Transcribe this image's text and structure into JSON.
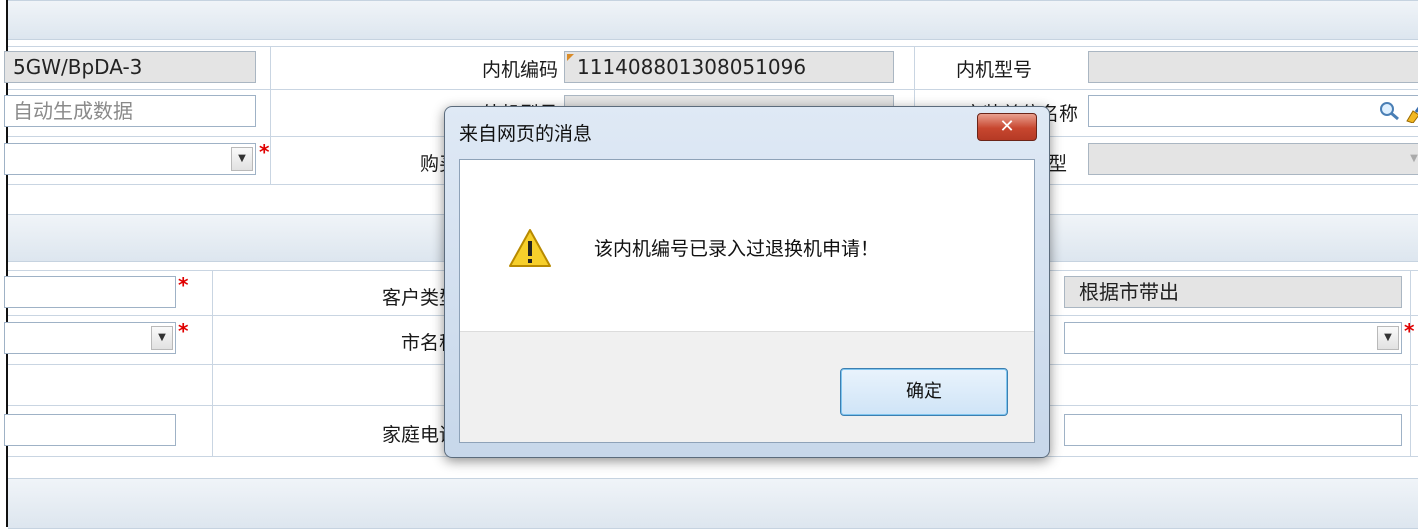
{
  "form": {
    "row1": {
      "model_value": "5GW/BpDA-3",
      "indoor_code_label": "内机编码",
      "indoor_code_value": "111408801308051096",
      "indoor_model_label": "内机型号"
    },
    "row2": {
      "auto_hint": "自动生成数据",
      "obscured_label": "外机型号",
      "right_label": "安装单位名称"
    },
    "row3": {
      "purchase_label": "购买",
      "type_label": "型"
    },
    "row4": {
      "customer_type_label": "客户类型",
      "city_auto_value": "根据市带出"
    },
    "row5": {
      "city_label": "市名称"
    },
    "row6": {
      "home_phone_label": "家庭电话"
    }
  },
  "dialog": {
    "title": "来自网页的消息",
    "close_glyph": "✕",
    "message": "该内机编号已录入过退换机申请！",
    "ok_label": "确定"
  },
  "icons": {
    "required_mark": "*",
    "dropdown_arrow": "▼"
  },
  "colors": {
    "required": "#e00000",
    "close_button": "#c7462f",
    "section_band": "#dde6ef"
  }
}
